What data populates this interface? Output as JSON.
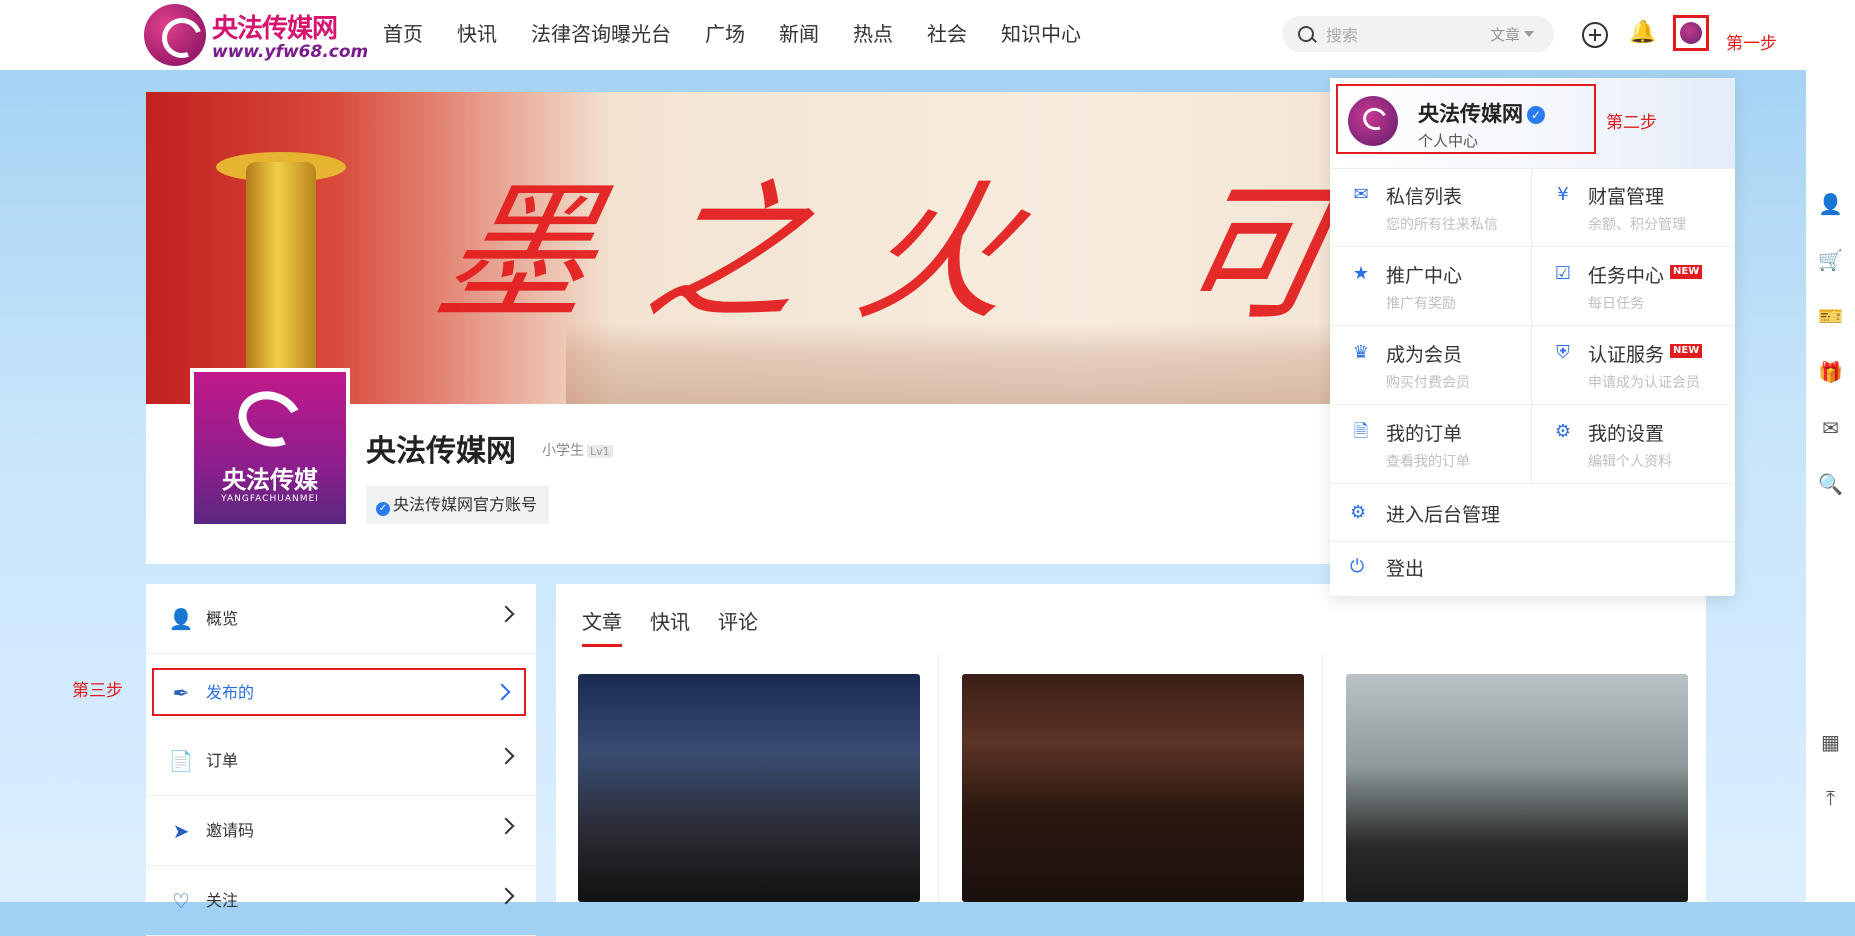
{
  "header": {
    "logo_title": "央法传媒网",
    "logo_url": "www.yfw68.com",
    "nav": [
      "首页",
      "快讯",
      "法律咨询曝光台",
      "广场",
      "新闻",
      "热点",
      "社会",
      "知识中心"
    ],
    "search_placeholder": "搜索",
    "search_type": "文章"
  },
  "annotations": {
    "step1": "第一步",
    "step2": "第二步",
    "step3": "第三步"
  },
  "profile": {
    "avatar_title": "央法传媒",
    "avatar_subtitle": "YANGFACHUANMEI",
    "name": "央法传媒网",
    "level": "小学生",
    "level_badge": "Lv1",
    "verify_badge": "✓",
    "tag": "央法传媒网官方账号"
  },
  "side_menu": [
    {
      "label": "概览",
      "icon": "user-icon"
    },
    {
      "label": "发布的",
      "icon": "feather-icon"
    },
    {
      "label": "订单",
      "icon": "document-icon"
    },
    {
      "label": "邀请码",
      "icon": "paper-plane-icon"
    },
    {
      "label": "关注",
      "icon": "heart-icon"
    }
  ],
  "content": {
    "tabs": [
      "文章",
      "快讯",
      "评论"
    ]
  },
  "dropdown": {
    "name": "央法传媒网",
    "verified": "✓",
    "subtitle": "个人中心",
    "items": [
      {
        "title": "私信列表",
        "sub": "您的所有往来私信",
        "icon": "mail-icon",
        "new": ""
      },
      {
        "title": "财富管理",
        "sub": "余额、积分管理",
        "icon": "money-bag-icon",
        "new": ""
      },
      {
        "title": "推广中心",
        "sub": "推广有奖励",
        "icon": "star-frame-icon",
        "new": ""
      },
      {
        "title": "任务中心",
        "sub": "每日任务",
        "icon": "checkbox-icon",
        "new": "NEW"
      },
      {
        "title": "成为会员",
        "sub": "购买付费会员",
        "icon": "crown-icon",
        "new": ""
      },
      {
        "title": "认证服务",
        "sub": "申请成为认证会员",
        "icon": "shield-icon",
        "new": "NEW"
      },
      {
        "title": "我的订单",
        "sub": "查看我的订单",
        "icon": "document-icon",
        "new": ""
      },
      {
        "title": "我的设置",
        "sub": "编辑个人资料",
        "icon": "gear-icon",
        "new": ""
      }
    ],
    "admin": "进入后台管理",
    "logout": "登出"
  },
  "right_bar": [
    "user-icon",
    "cart-icon",
    "ticket-icon",
    "gift-icon",
    "mail-icon",
    "search-icon",
    "qrcode-icon",
    "back-to-top-icon"
  ],
  "colors": {
    "accent_red": "#e21c1c",
    "accent_blue": "#2a6ee8",
    "brand_pink": "#d6136e"
  }
}
